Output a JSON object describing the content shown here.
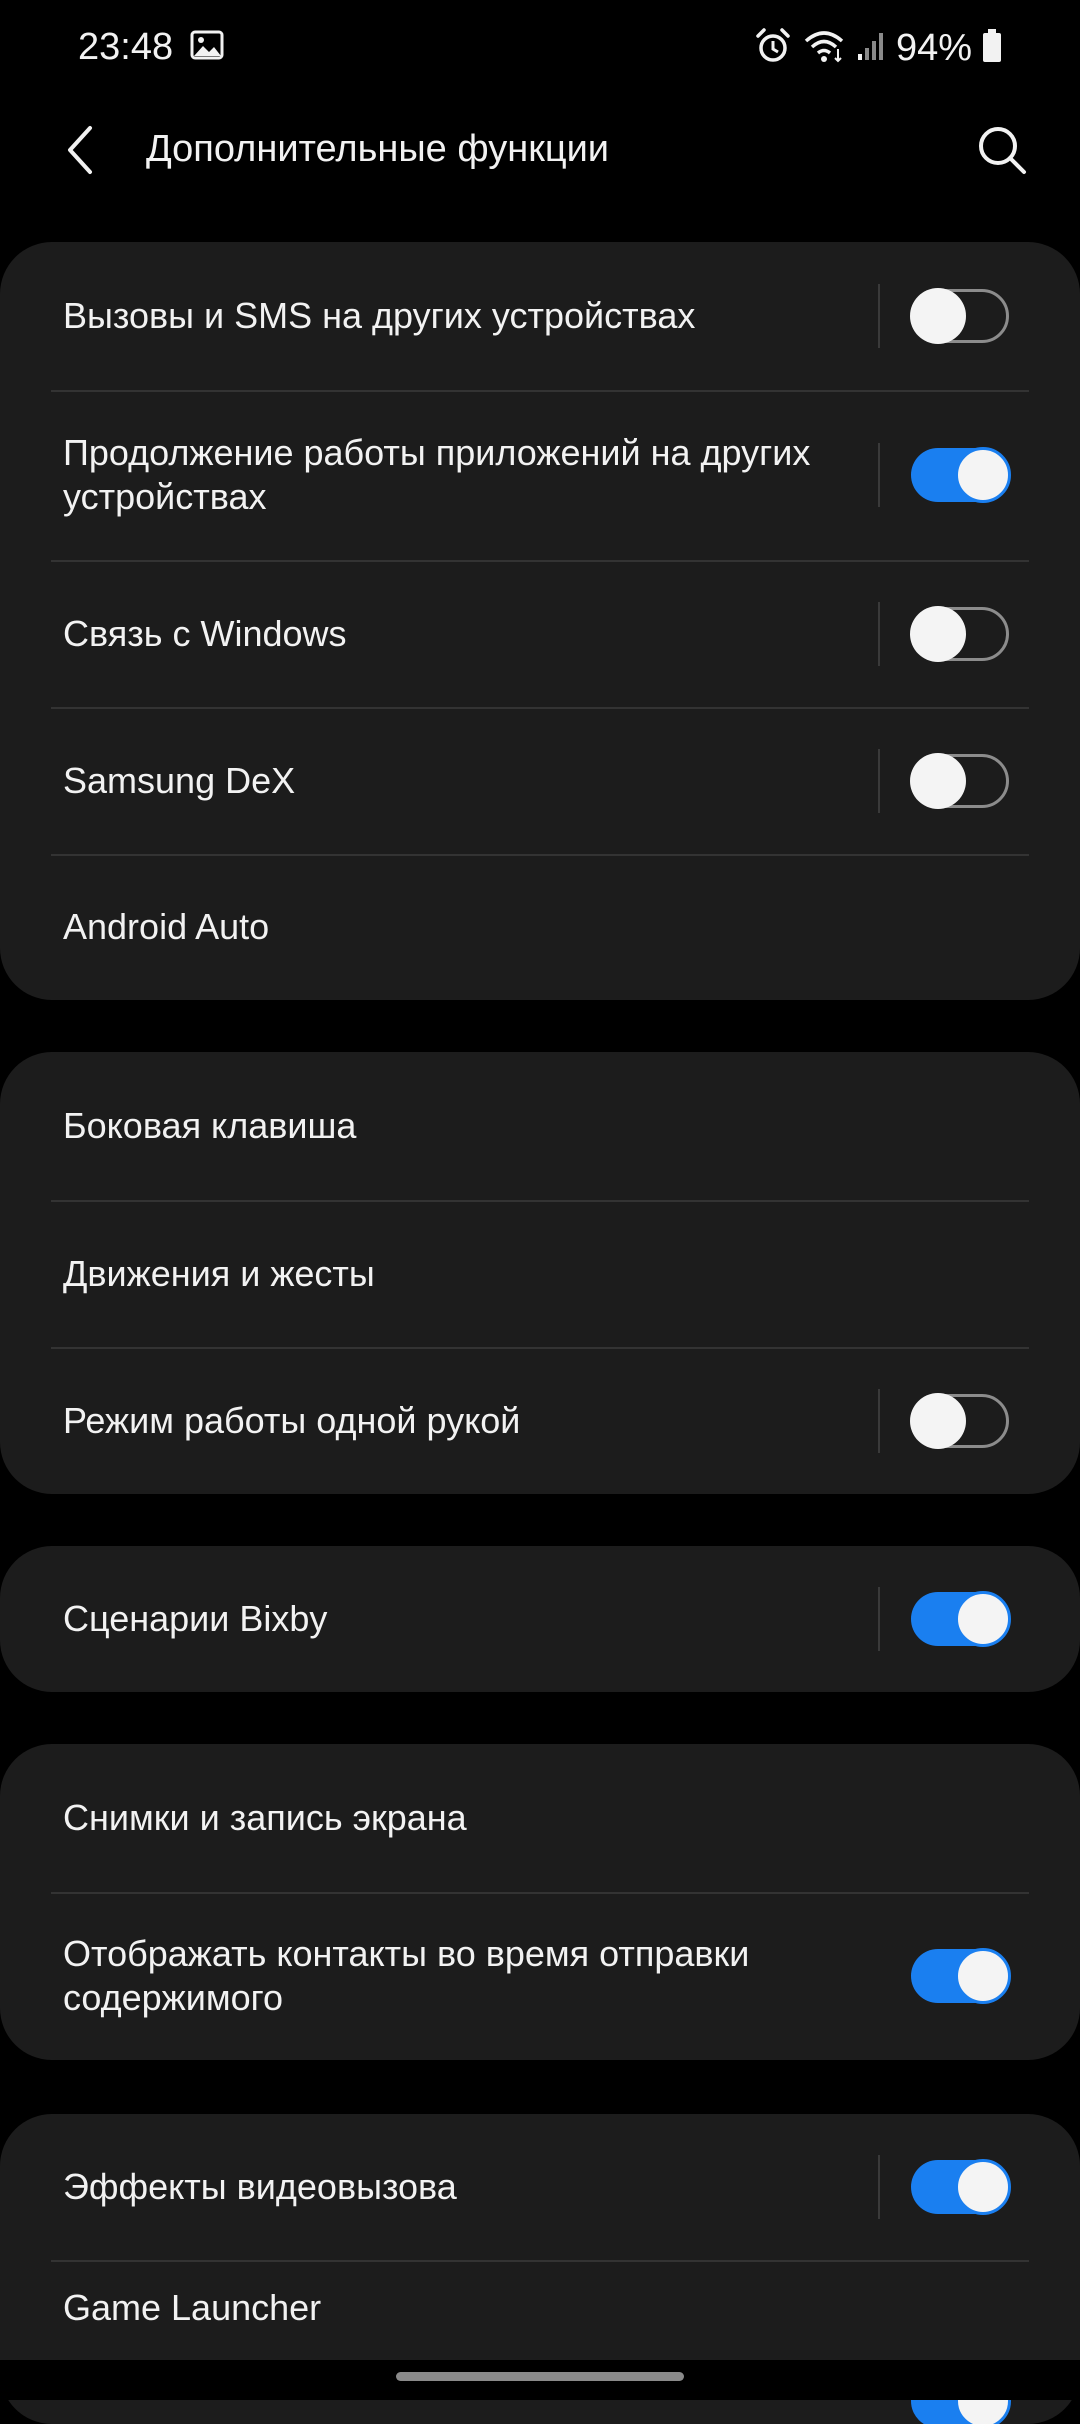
{
  "status_bar": {
    "time": "23:48",
    "battery_percent": "94%",
    "icons": [
      "gallery-icon",
      "alarm-icon",
      "wifi-icon",
      "signal-icon",
      "battery-icon"
    ]
  },
  "header": {
    "title": "Дополнительные функции",
    "back_icon": "chevron-left-icon",
    "search_icon": "search-icon"
  },
  "colors": {
    "background": "#000000",
    "card": "#1c1c1c",
    "accent": "#1a7ff0",
    "text": "#f2f2f2"
  },
  "groups": [
    {
      "items": [
        {
          "label": "Вызовы и SMS на других устройствах",
          "toggle": "off"
        },
        {
          "label": "Продолжение работы приложений на других устройствах",
          "toggle": "on"
        },
        {
          "label": "Связь с Windows",
          "toggle": "off"
        },
        {
          "label": "Samsung DeX",
          "toggle": "off"
        },
        {
          "label": "Android Auto",
          "toggle": null
        }
      ]
    },
    {
      "items": [
        {
          "label": "Боковая клавиша",
          "toggle": null
        },
        {
          "label": "Движения и жесты",
          "toggle": null
        },
        {
          "label": "Режим работы одной рукой",
          "toggle": "off"
        }
      ]
    },
    {
      "items": [
        {
          "label": "Сценарии Bixby",
          "toggle": "on"
        }
      ]
    },
    {
      "items": [
        {
          "label": "Снимки и запись экрана",
          "toggle": null
        },
        {
          "label": "Отображать контакты во время отправки содержимого",
          "toggle": "on"
        }
      ]
    },
    {
      "items": [
        {
          "label": "Эффекты видеовызова",
          "toggle": "on"
        },
        {
          "label": "Game Launcher",
          "toggle": "on"
        }
      ]
    }
  ]
}
